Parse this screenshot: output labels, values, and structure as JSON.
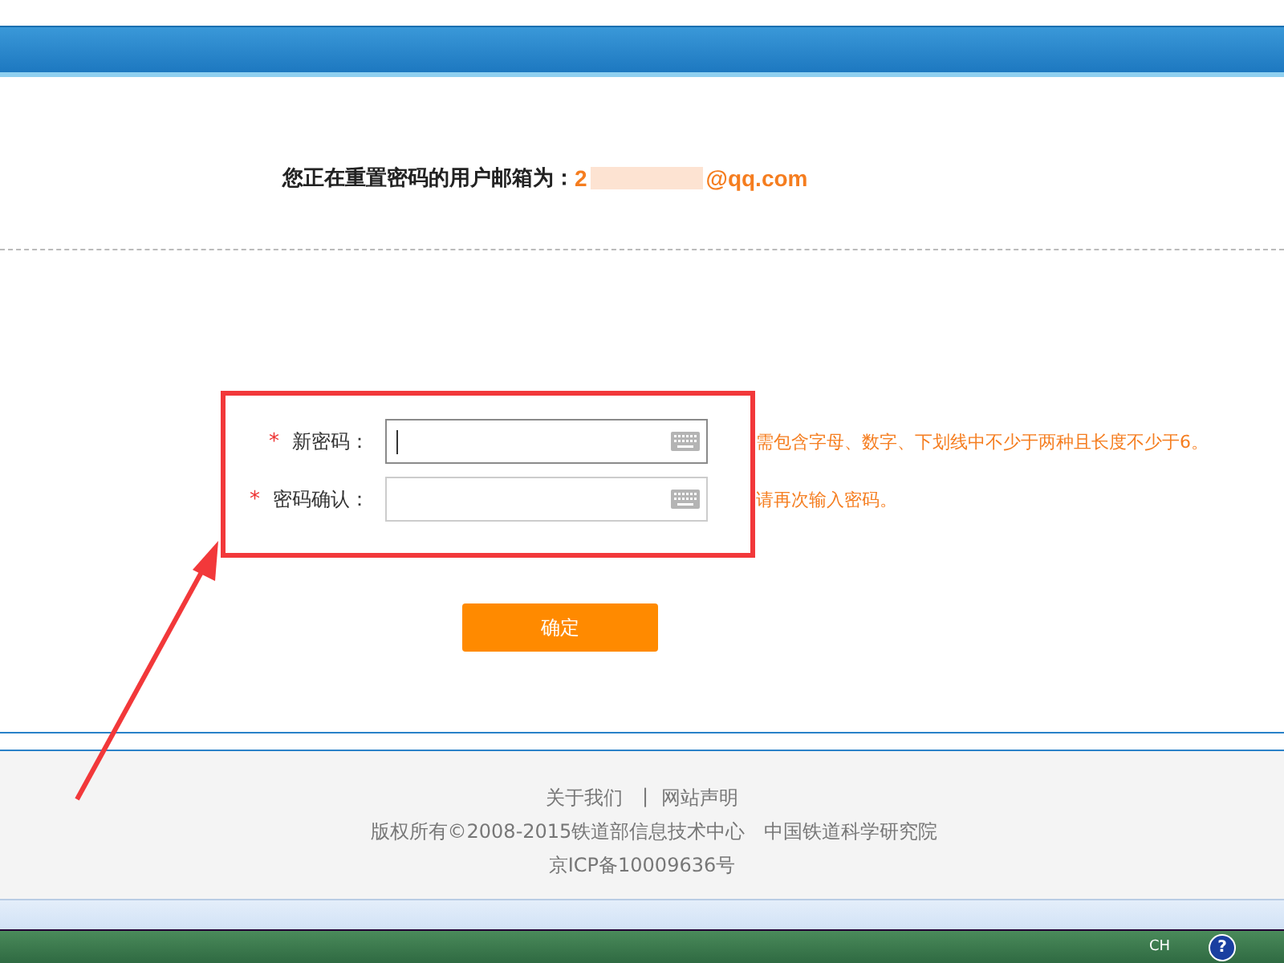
{
  "notice": {
    "label": "您正在重置密码的用户邮箱为：",
    "email_start": "2",
    "email_end": "@qq.com"
  },
  "form": {
    "fields": [
      {
        "required_mark": "*",
        "label": "新密码：",
        "hint": "需包含字母、数字、下划线中不少于两种且长度不少于6。",
        "focused": true
      },
      {
        "required_mark": "*",
        "label": "密码确认：",
        "hint": "请再次输入密码。",
        "focused": false
      }
    ],
    "submit": "确定"
  },
  "footer": {
    "links": [
      "关于我们",
      "网站声明"
    ],
    "separator": "|",
    "copyright": "版权所有©2008-2015铁道部信息技术中心",
    "institute": "中国铁道科学研究院",
    "icp": "京ICP备10009636号"
  },
  "taskbar": {
    "language": "CH",
    "help": "?"
  }
}
